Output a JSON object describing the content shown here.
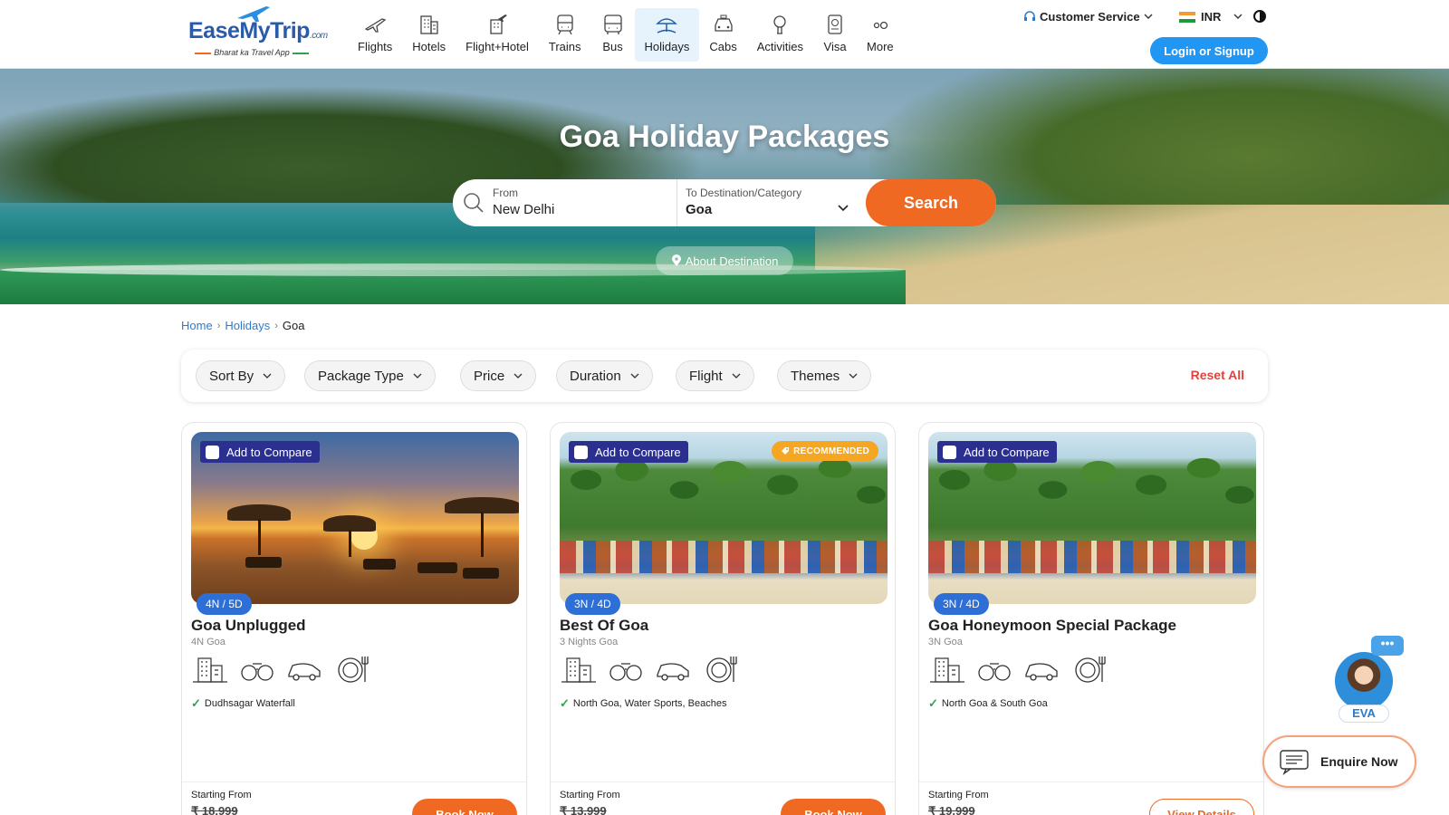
{
  "brand": {
    "name": "EaseMyTrip",
    "suffix": ".com",
    "tagline": "Bharat ka Travel App"
  },
  "nav": [
    {
      "label": "Flights",
      "icon": "plane-icon"
    },
    {
      "label": "Hotels",
      "icon": "hotel-icon"
    },
    {
      "label": "Flight+Hotel",
      "icon": "flight-hotel-icon"
    },
    {
      "label": "Trains",
      "icon": "train-icon"
    },
    {
      "label": "Bus",
      "icon": "bus-icon"
    },
    {
      "label": "Holidays",
      "icon": "holidays-icon",
      "active": true
    },
    {
      "label": "Cabs",
      "icon": "cab-icon"
    },
    {
      "label": "Activities",
      "icon": "activities-icon"
    },
    {
      "label": "Visa",
      "icon": "visa-icon"
    },
    {
      "label": "More",
      "icon": "more-icon"
    }
  ],
  "header": {
    "customer_service": "Customer Service",
    "currency": "INR",
    "login": "Login or Signup"
  },
  "hero": {
    "title": "Goa Holiday Packages",
    "from_label": "From",
    "from_value": "New Delhi",
    "dest_label": "To Destination/Category",
    "dest_value": "Goa",
    "search": "Search",
    "about": "About Destination"
  },
  "breadcrumb": {
    "home": "Home",
    "holidays": "Holidays",
    "current": "Goa"
  },
  "filters": {
    "chips": [
      "Sort By",
      "Package Type",
      "Price",
      "Duration",
      "Flight",
      "Themes"
    ],
    "reset": "Reset All"
  },
  "cards": [
    {
      "compare": "Add to Compare",
      "duration": "4N / 5D",
      "title": "Goa Unplugged",
      "subtitle": "4N Goa",
      "highlight": "Dudhsagar Waterfall",
      "starting": "Starting From",
      "price": "₹ 18,999",
      "action": "Book Now"
    },
    {
      "compare": "Add to Compare",
      "badge": "RECOMMENDED",
      "duration": "3N / 4D",
      "title": "Best Of Goa",
      "subtitle": "3 Nights Goa",
      "highlight": "North Goa, Water Sports, Beaches",
      "starting": "Starting From",
      "price": "₹ 13,999",
      "action": "Book Now"
    },
    {
      "compare": "Add to Compare",
      "duration": "3N / 4D",
      "title": "Goa Honeymoon Special Package",
      "subtitle": "3N Goa",
      "highlight": "North Goa & South Goa",
      "starting": "Starting From",
      "price": "₹ 19,999",
      "action": "View Details"
    }
  ],
  "widgets": {
    "eva": "EVA",
    "enquire": "Enquire Now"
  },
  "colors": {
    "primary": "#2196f3",
    "accent": "#f06922",
    "compare": "#2b2f8f",
    "duration": "#2d6fd6"
  }
}
